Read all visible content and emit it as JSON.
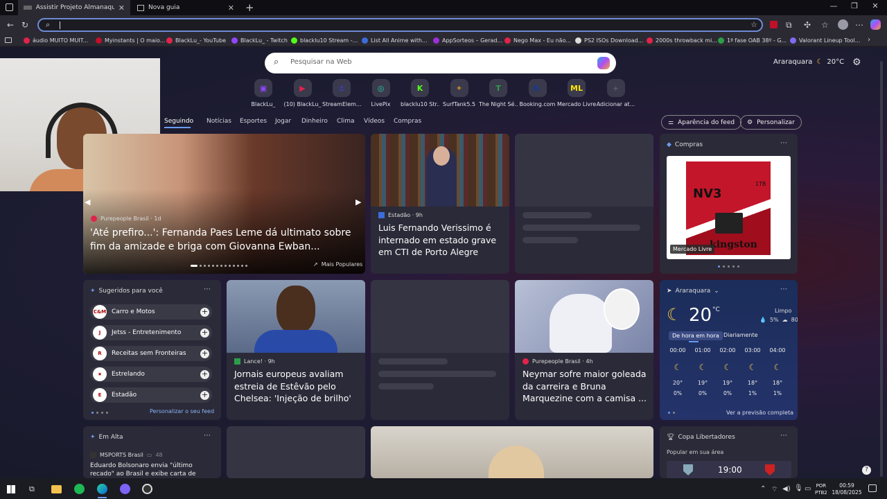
{
  "tabs": [
    {
      "title": "Assistir Projeto Almanaque Dubl..."
    },
    {
      "title": "Nova guia"
    }
  ],
  "window_buttons": {
    "minimize": "—",
    "maximize": "❐",
    "close": "✕"
  },
  "address": {
    "value": "",
    "placeholder": ""
  },
  "bookmarks": [
    {
      "label": "áudio MUITO MUIT...",
      "color": "#e0244a"
    },
    {
      "label": "Myinstants | O maio...",
      "color": "#c0102a"
    },
    {
      "label": "BlackLu_- YouTube",
      "color": "#e0244a"
    },
    {
      "label": "BlackLu_ - Twitch",
      "color": "#9146ff"
    },
    {
      "label": "blacklu10 Stream -...",
      "color": "#53fc18"
    },
    {
      "label": "List All Anime with...",
      "color": "#3b6dd8"
    },
    {
      "label": "AppSorteos – Gerad...",
      "color": "#9b30d9"
    },
    {
      "label": "Nego Max - Eu não...",
      "color": "#e0244a"
    },
    {
      "label": "PS2 ISOs Download...",
      "color": "#dddddd"
    },
    {
      "label": "2000s throwback mi...",
      "color": "#e0244a"
    },
    {
      "label": "1ª fase OAB 38º - G...",
      "color": "#2d9d4a"
    },
    {
      "label": "Valorant Lineup Tool...",
      "color": "#7c6df0"
    }
  ],
  "search": {
    "placeholder": "Pesquisar na Web"
  },
  "weather_top": {
    "city": "Araraquara",
    "temp": "20°C"
  },
  "quick_links": [
    {
      "label": "BlackLu_",
      "glyph": "▣",
      "color": "#9146ff"
    },
    {
      "label": "(10) BlackLu_",
      "glyph": "▶",
      "color": "#e0244a"
    },
    {
      "label": "StreamElem...",
      "glyph": "⚓",
      "color": "#3a3fd8"
    },
    {
      "label": "LivePix",
      "glyph": "◎",
      "color": "#28c9a9"
    },
    {
      "label": "blacklu10 Str...",
      "glyph": "K",
      "color": "#53fc18"
    },
    {
      "label": "SurfTank5.5",
      "glyph": "✦",
      "color": "#c08a20"
    },
    {
      "label": "The Night Sé...",
      "glyph": "T",
      "color": "#2d9d4a"
    },
    {
      "label": "Booking.com",
      "glyph": "B.",
      "color": "#1a3a8a"
    },
    {
      "label": "Mercado Livre",
      "glyph": "ML",
      "color": "#ffe600"
    },
    {
      "label": "Adicionar at...",
      "glyph": "+",
      "color": "#5a5a66"
    }
  ],
  "feed_nav": [
    "Seguindo",
    "Notícias",
    "Esportes",
    "Jogar",
    "Dinheiro",
    "Clima",
    "Vídeos",
    "Compras"
  ],
  "feed_buttons": {
    "appearance": "Aparência do feed",
    "personalize": "Personalizar"
  },
  "hero": {
    "source": "Purepeople Brasil · 1d",
    "headline": "'Até prefiro...': Fernanda Paes Leme dá ultimato sobre fim da amizade e briga com Giovanna Ewban...",
    "tag": "Mais Populares"
  },
  "news1": {
    "source": "Estadão · 9h",
    "headline": "Luis Fernando Verissimo é internado em estado grave em CTI de Porto Alegre"
  },
  "shopping": {
    "title": "Compras",
    "badge": "Mercado Livre",
    "product_brand": "kingston",
    "product_name": "NV3",
    "product_size": "1TB"
  },
  "suggested": {
    "title": "Sugeridos para você",
    "items": [
      {
        "label": "Carro e Motos",
        "avatar": "C&M"
      },
      {
        "label": "Jetss - Entretenimento",
        "avatar": "J"
      },
      {
        "label": "Receitas sem Fronteiras",
        "avatar": "R"
      },
      {
        "label": "Estrelando",
        "avatar": "★"
      },
      {
        "label": "Estadão",
        "avatar": "E"
      }
    ],
    "link": "Personalizar o seu feed"
  },
  "news2": {
    "source": "Lance! · 9h",
    "headline": "Jornais europeus avaliam estreia de Estêvão pelo Chelsea: 'Injeção de brilho'"
  },
  "news3": {
    "source": "Purepeople Brasil · 4h",
    "headline": "Neymar sofre maior goleada da carreira e Bruna Marquezine com a camisa ..."
  },
  "weather": {
    "city": "Araraquara",
    "temp": "20",
    "unit": "°C",
    "condition": "Limpo",
    "precip": "5%",
    "humidity": "80",
    "tab_hourly": "De hora em hora",
    "tab_daily": "Diariamente",
    "hours": [
      {
        "time": "00:00",
        "temp": "20°",
        "rain": "0%"
      },
      {
        "time": "01:00",
        "temp": "19°",
        "rain": "0%"
      },
      {
        "time": "02:00",
        "temp": "19°",
        "rain": "0%"
      },
      {
        "time": "03:00",
        "temp": "18°",
        "rain": "1%"
      },
      {
        "time": "04:00",
        "temp": "18°",
        "rain": "1%"
      }
    ],
    "link": "Ver a previsão completa"
  },
  "trending": {
    "title": "Em Alta",
    "source": "MSPORTS Brasil",
    "count": "48",
    "headline": "Eduardo Bolsonaro envia \"último recado\" ao Brasil e exibe carta de Trump em defe..."
  },
  "libertadores": {
    "title": "Copa Libertadores",
    "subtitle": "Popular em sua área",
    "time": "19:00"
  },
  "tray": {
    "lang1": "POR",
    "lang2": "PTB2",
    "time": "00:59",
    "date": "18/08/2025"
  }
}
